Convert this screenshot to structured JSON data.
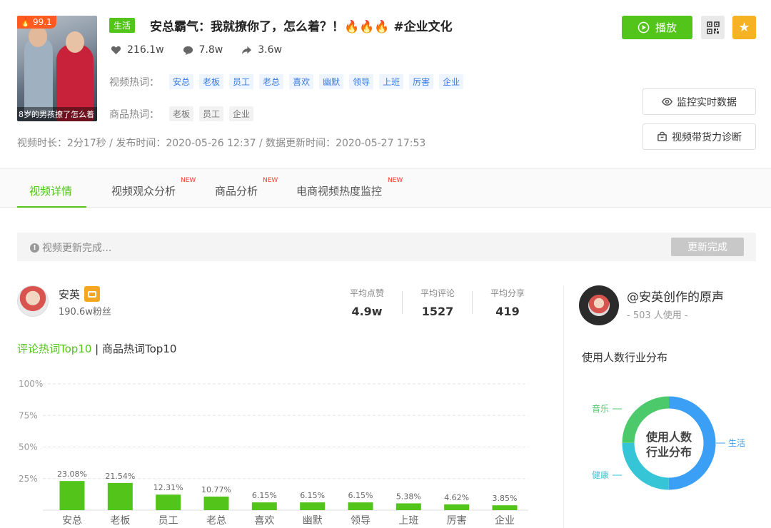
{
  "video": {
    "hot_score": "99.1",
    "thumb_caption": "8岁的男孩撩了怎么着",
    "category": "生活",
    "title": "安总霸气：我就撩你了，怎么着？！🔥🔥🔥 #企业文化",
    "likes": "216.1w",
    "comments": "7.8w",
    "shares": "3.6w",
    "video_hot_label": "视频热词：",
    "video_hot_words": [
      "安总",
      "老板",
      "员工",
      "老总",
      "喜欢",
      "幽默",
      "领导",
      "上班",
      "厉害",
      "企业"
    ],
    "product_hot_label": "商品热词：",
    "product_hot_words": [
      "老板",
      "员工",
      "企业"
    ],
    "meta": "视频时长：2分17秒 / 发布时间：2020-05-26 12:37 / 数据更新时间：2020-05-27 17:53"
  },
  "actions": {
    "play_label": "播放",
    "monitor_label": "监控实时数据",
    "diagnose_label": "视频带货力诊断"
  },
  "tabs": [
    {
      "label": "视频详情",
      "new": ""
    },
    {
      "label": "视频观众分析",
      "new": "NEW"
    },
    {
      "label": "商品分析",
      "new": "NEW"
    },
    {
      "label": "电商视频热度监控",
      "new": "NEW"
    }
  ],
  "update": {
    "text": "视频更新完成...",
    "button": "更新完成"
  },
  "author": {
    "name": "安英",
    "fans": "190.6w粉丝",
    "avg_likes_label": "平均点赞",
    "avg_likes": "4.9w",
    "avg_comments_label": "平均评论",
    "avg_comments": "1527",
    "avg_shares_label": "平均分享",
    "avg_shares": "419"
  },
  "hot_tabs": {
    "active": "评论热词Top10",
    "separator": " | ",
    "inactive": "商品热词Top10"
  },
  "chart_data": {
    "type": "bar",
    "categories": [
      "安总",
      "老板",
      "员工",
      "老总",
      "喜欢",
      "幽默",
      "领导",
      "上班",
      "厉害",
      "企业"
    ],
    "values": [
      23.08,
      21.54,
      12.31,
      10.77,
      6.15,
      6.15,
      6.15,
      5.38,
      4.62,
      3.85
    ],
    "value_labels": [
      "23.08%",
      "21.54%",
      "12.31%",
      "10.77%",
      "6.15%",
      "6.15%",
      "6.15%",
      "5.38%",
      "4.62%",
      "3.85%"
    ],
    "y_ticks": [
      "100%",
      "75%",
      "50%",
      "25%"
    ],
    "ylim": [
      0,
      100
    ],
    "color": "#52c41a"
  },
  "music": {
    "name": "@安英创作的原声",
    "usage": "- 503 人使用 -",
    "dist_title": "使用人数行业分布",
    "donut_center_line1": "使用人数",
    "donut_center_line2": "行业分布",
    "segments": [
      {
        "label": "生活",
        "fraction": 0.5,
        "color": "#3a9ff5"
      },
      {
        "label": "健康",
        "fraction": 0.25,
        "color": "#36c5d6"
      },
      {
        "label": "音乐",
        "fraction": 0.25,
        "color": "#4cc96b"
      }
    ]
  }
}
